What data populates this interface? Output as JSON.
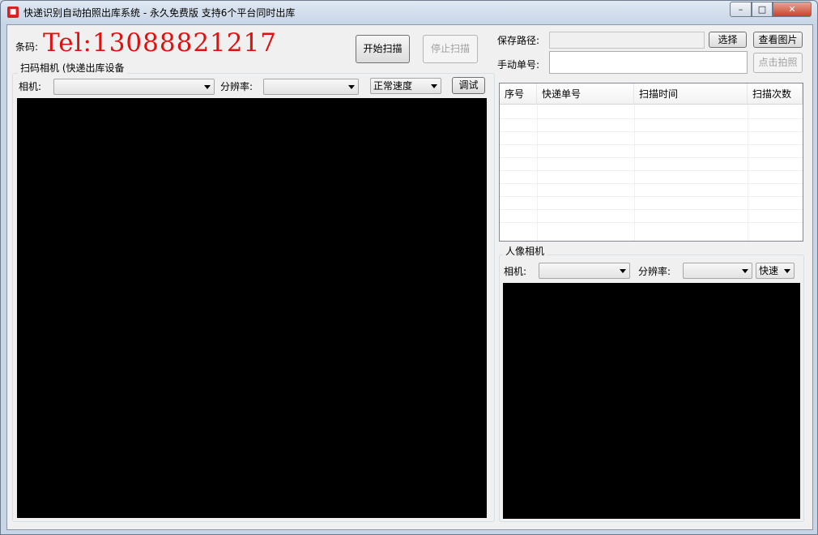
{
  "window": {
    "title": "快递识别自动拍照出库系统 - 永久免费版 支持6个平台同时出库",
    "icon": "app-logo-icon",
    "minimize": "–",
    "maximize": "□",
    "close": "✕"
  },
  "barcode": {
    "label": "条码:",
    "value": "Tel:13088821217"
  },
  "scan_buttons": {
    "start": "开始扫描",
    "stop": "停止扫描"
  },
  "scan_camera": {
    "group_title": "扫码相机 (快递出库设备",
    "camera_label": "相机:",
    "camera_value": "",
    "resolution_label": "分辨率:",
    "resolution_value": "",
    "speed_value": "正常速度",
    "debug_button": "调试"
  },
  "save": {
    "path_label": "保存路径:",
    "path_value": "",
    "select_button": "选择",
    "view_button": "查看图片"
  },
  "manual": {
    "label": "手动单号:",
    "value": "",
    "capture_button": "点击拍照"
  },
  "table": {
    "columns": [
      "序号",
      "快递单号",
      "扫描时间",
      "扫描次数"
    ],
    "rows": []
  },
  "portrait_camera": {
    "group_title": "人像相机",
    "camera_label": "相机:",
    "camera_value": "",
    "resolution_label": "分辨率:",
    "resolution_value": "",
    "speed_value": "快速"
  }
}
